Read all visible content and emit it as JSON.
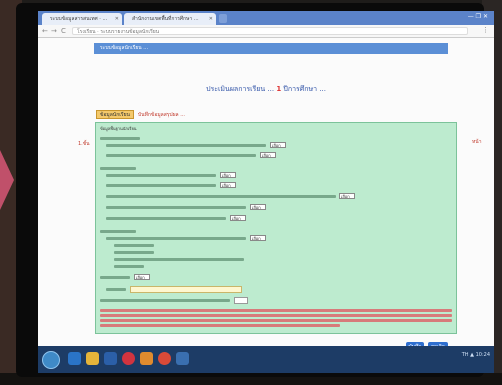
{
  "browser": {
    "tab1_title": "ระบบข้อมูลสารสนเทศ · ...",
    "tab2_title": "สำนักงานเขตพื้นที่การศึกษา ...",
    "url": "โรงเรียน · ระบบรายงานข้อมูลนักเรียน",
    "window_controls": "— ❐ ✕",
    "back": "←",
    "forward": "→",
    "reload": "C",
    "menu": "⋮"
  },
  "page": {
    "panel_header": "ระบบข้อมูลนักเรียน ...",
    "title_main": "ประเมินผลการเรียน ...",
    "title_highlight": "1",
    "title_suffix": "ปีการศึกษา ...",
    "tab_active": "ข้อมูลนักเรียน",
    "tab_inactive": "บันทึกข้อมูลสรุปผล ...",
    "side_left": "1.ชั้น",
    "side_right": "หน้า",
    "form_heading": "ข้อมูลพื้นฐานนักเรียน",
    "select_value": "เลือก",
    "save_button": "บันทึก",
    "cancel_button": "ยกเลิก"
  },
  "taskbar": {
    "tray_text": "TH ▲ 10:24"
  },
  "colors": {
    "browser_chrome": "#5b83c9",
    "panel_header": "#5b8fd6",
    "form_background": "#bdebcf",
    "active_tab": "#f4c96b",
    "accent_red": "#d33",
    "button_blue": "#2e6fd0",
    "taskbar": "#1d3c66"
  }
}
